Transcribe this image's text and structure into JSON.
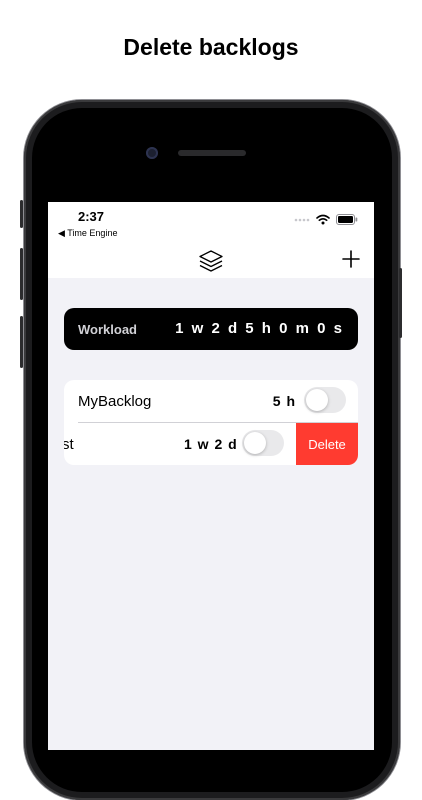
{
  "headline": "Delete backlogs",
  "status_bar": {
    "time": "2:37",
    "back_app": "◀ Time Engine"
  },
  "workload": {
    "label": "Workload",
    "value": "1 w 2 d 5 h 0 m 0 s"
  },
  "backlogs": [
    {
      "name": "MyBacklog",
      "duration": "5 h",
      "enabled": false
    },
    {
      "name": "st",
      "duration": "1 w 2 d",
      "enabled": false
    }
  ],
  "delete_label": "Delete",
  "colors": {
    "accent_delete": "#ff3b30",
    "workload_bg": "#000000",
    "screen_bg": "#f2f2f7"
  }
}
